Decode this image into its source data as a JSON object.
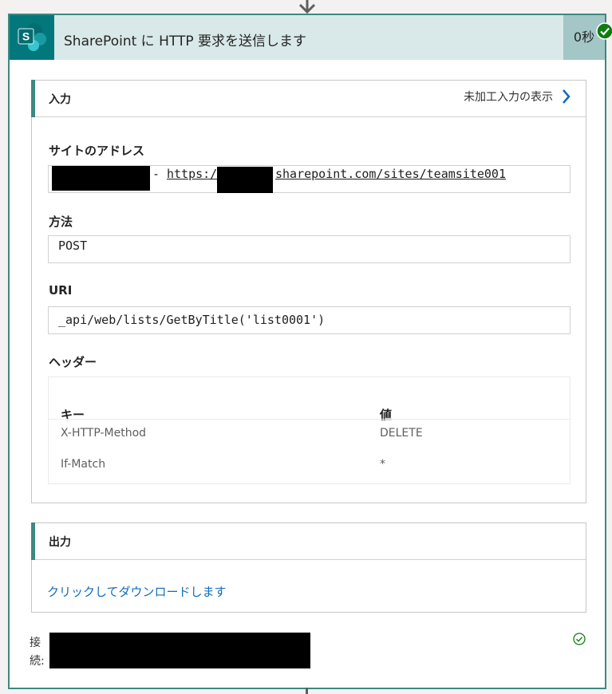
{
  "action": {
    "title": "SharePoint に HTTP 要求を送信します",
    "duration": "0秒",
    "status": "succeeded"
  },
  "inputs": {
    "title": "入力",
    "raw_link": "未加工入力の表示",
    "site_address": {
      "label": "サイトのアドレス",
      "separator": "-",
      "url_prefix": "https:/",
      "url_suffix": "sharepoint.com/sites/teamsite001"
    },
    "method": {
      "label": "方法",
      "value": "POST"
    },
    "uri": {
      "label": "URI",
      "value": "_api/web/lists/GetByTitle('list0001')"
    },
    "headers": {
      "label": "ヘッダー",
      "columns": [
        "キー",
        "値"
      ],
      "rows": [
        {
          "key": "X-HTTP-Method",
          "value": "DELETE"
        },
        {
          "key": "If-Match",
          "value": "*"
        }
      ]
    }
  },
  "outputs": {
    "title": "出力",
    "download_link": "クリックしてダウンロードします"
  },
  "connection": {
    "label_line1": "接",
    "label_line2": "続:"
  },
  "colors": {
    "accent": "#3c8a82",
    "header_bg": "#d9e8e8",
    "duration_bg": "#a3c6c6",
    "app_icon_bg": "#03787c",
    "success": "#107c10",
    "link": "#0f6cbd"
  }
}
